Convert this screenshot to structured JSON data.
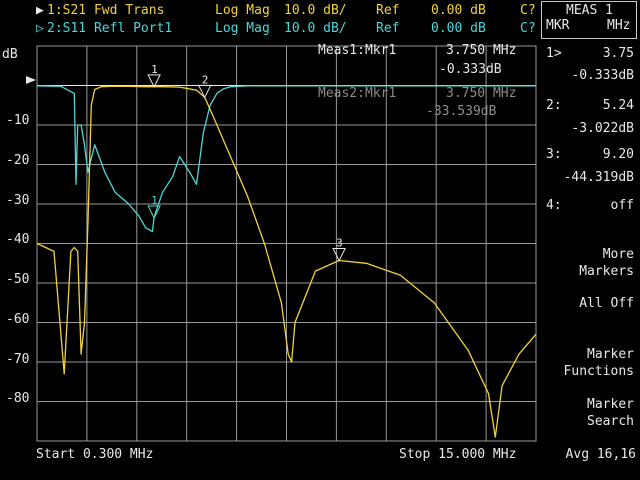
{
  "header": {
    "trace1": {
      "marker": "▶",
      "name": "1:S21 Fwd Trans",
      "format": "Log Mag",
      "scale": "10.0 dB/",
      "ref_label": "Ref",
      "ref_value": "0.00 dB",
      "flag": "C?"
    },
    "trace2": {
      "marker": "▷",
      "name": "2:S11 Refl Port1",
      "format": "Log Mag",
      "scale": "10.0 dB/",
      "ref_label": "Ref",
      "ref_value": "0.00 dB",
      "flag": "C?"
    }
  },
  "plot": {
    "unit": "dB",
    "y_ticks": [
      "-10",
      "-20",
      "-30",
      "-40",
      "-50",
      "-60",
      "-70",
      "-80"
    ],
    "start": "Start 0.300 MHz",
    "stop": "Stop 15.000 MHz"
  },
  "marker_readout": {
    "meas1_label": "Meas1:Mkr1",
    "meas1_freq": "3.750 MHz",
    "meas1_value": "-0.333dB",
    "meas2_label": "Meas2:Mkr1",
    "meas2_freq": "3.750 MHz",
    "meas2_value": "-33.539dB"
  },
  "right_panel": {
    "title": "MEAS 1",
    "sub_left": "MKR",
    "sub_right": "MHz",
    "markers": [
      {
        "id": "1>",
        "freq": "3.75",
        "value": "-0.333dB"
      },
      {
        "id": "2:",
        "freq": "5.24",
        "value": "-3.022dB"
      },
      {
        "id": "3:",
        "freq": "9.20",
        "value": "-44.319dB"
      },
      {
        "id": "4:",
        "freq": "off"
      }
    ],
    "softkeys": {
      "more_1": "More",
      "more_2": "Markers",
      "all_off": "All Off",
      "func_1": "Marker",
      "func_2": "Functions",
      "search_1": "Marker",
      "search_2": "Search"
    },
    "avg": "Avg 16,16"
  },
  "trace_labels": {
    "m1": "1",
    "m2": "2",
    "m3": "3"
  },
  "colors": {
    "trace1": "#f2d23c",
    "trace2": "#4fd6d6",
    "grid": "#9a9a9a",
    "ref": "#e8e8e8"
  },
  "chart_data": {
    "type": "line",
    "x_range": [
      0.3,
      15.0
    ],
    "ylim": [
      -90,
      10
    ],
    "y_per_div": 10,
    "grid": true,
    "series": [
      {
        "name": "1:S21 Fwd Trans",
        "x": [
          0.3,
          0.8,
          1.1,
          1.3,
          1.4,
          1.5,
          1.6,
          1.7,
          1.8,
          1.9,
          2.0,
          2.2,
          2.5,
          3.0,
          3.5,
          4.0,
          4.5,
          5.0,
          5.24,
          5.5,
          6.0,
          6.5,
          7.0,
          7.5,
          7.7,
          7.8,
          7.9,
          8.5,
          9.2,
          10.0,
          11.0,
          12.0,
          13.0,
          13.6,
          13.8,
          14.0,
          14.5,
          15.0
        ],
        "y": [
          -40,
          -42,
          -73,
          -42,
          -41,
          -42,
          -68,
          -60,
          -35,
          -5,
          -1,
          -0.3,
          -0.2,
          -0.2,
          -0.3,
          -0.3,
          -0.4,
          -1.2,
          -3.0,
          -8,
          -18,
          -28,
          -40,
          -55,
          -68,
          -70,
          -60,
          -47,
          -44.3,
          -45,
          -48,
          -55,
          -67,
          -78,
          -89,
          -76,
          -68,
          -63
        ]
      },
      {
        "name": "2:S11 Refl Port1",
        "x": [
          0.3,
          1.0,
          1.4,
          1.45,
          1.5,
          1.6,
          1.7,
          1.8,
          2.0,
          2.3,
          2.6,
          3.0,
          3.3,
          3.5,
          3.7,
          3.75,
          3.8,
          4.0,
          4.3,
          4.5,
          4.8,
          5.0,
          5.2,
          5.4,
          5.6,
          5.8,
          6.0,
          6.5,
          15.0
        ],
        "y": [
          -0.1,
          -0.2,
          -2,
          -25,
          -10,
          -10,
          -15,
          -22,
          -15,
          -22,
          -27,
          -30,
          -33,
          -36,
          -37,
          -33.5,
          -32,
          -27,
          -23,
          -18,
          -22,
          -25,
          -12,
          -5,
          -2,
          -0.8,
          -0.3,
          -0.1,
          -0.1
        ]
      }
    ],
    "markers": [
      {
        "id": "1",
        "x": 3.75,
        "y": -0.333,
        "series": 0
      },
      {
        "id": "2",
        "x": 5.24,
        "y": -3.022,
        "series": 0
      },
      {
        "id": "3",
        "x": 9.2,
        "y": -44.319,
        "series": 0
      },
      {
        "id": "1",
        "x": 3.75,
        "y": -33.539,
        "series": 1
      }
    ]
  }
}
